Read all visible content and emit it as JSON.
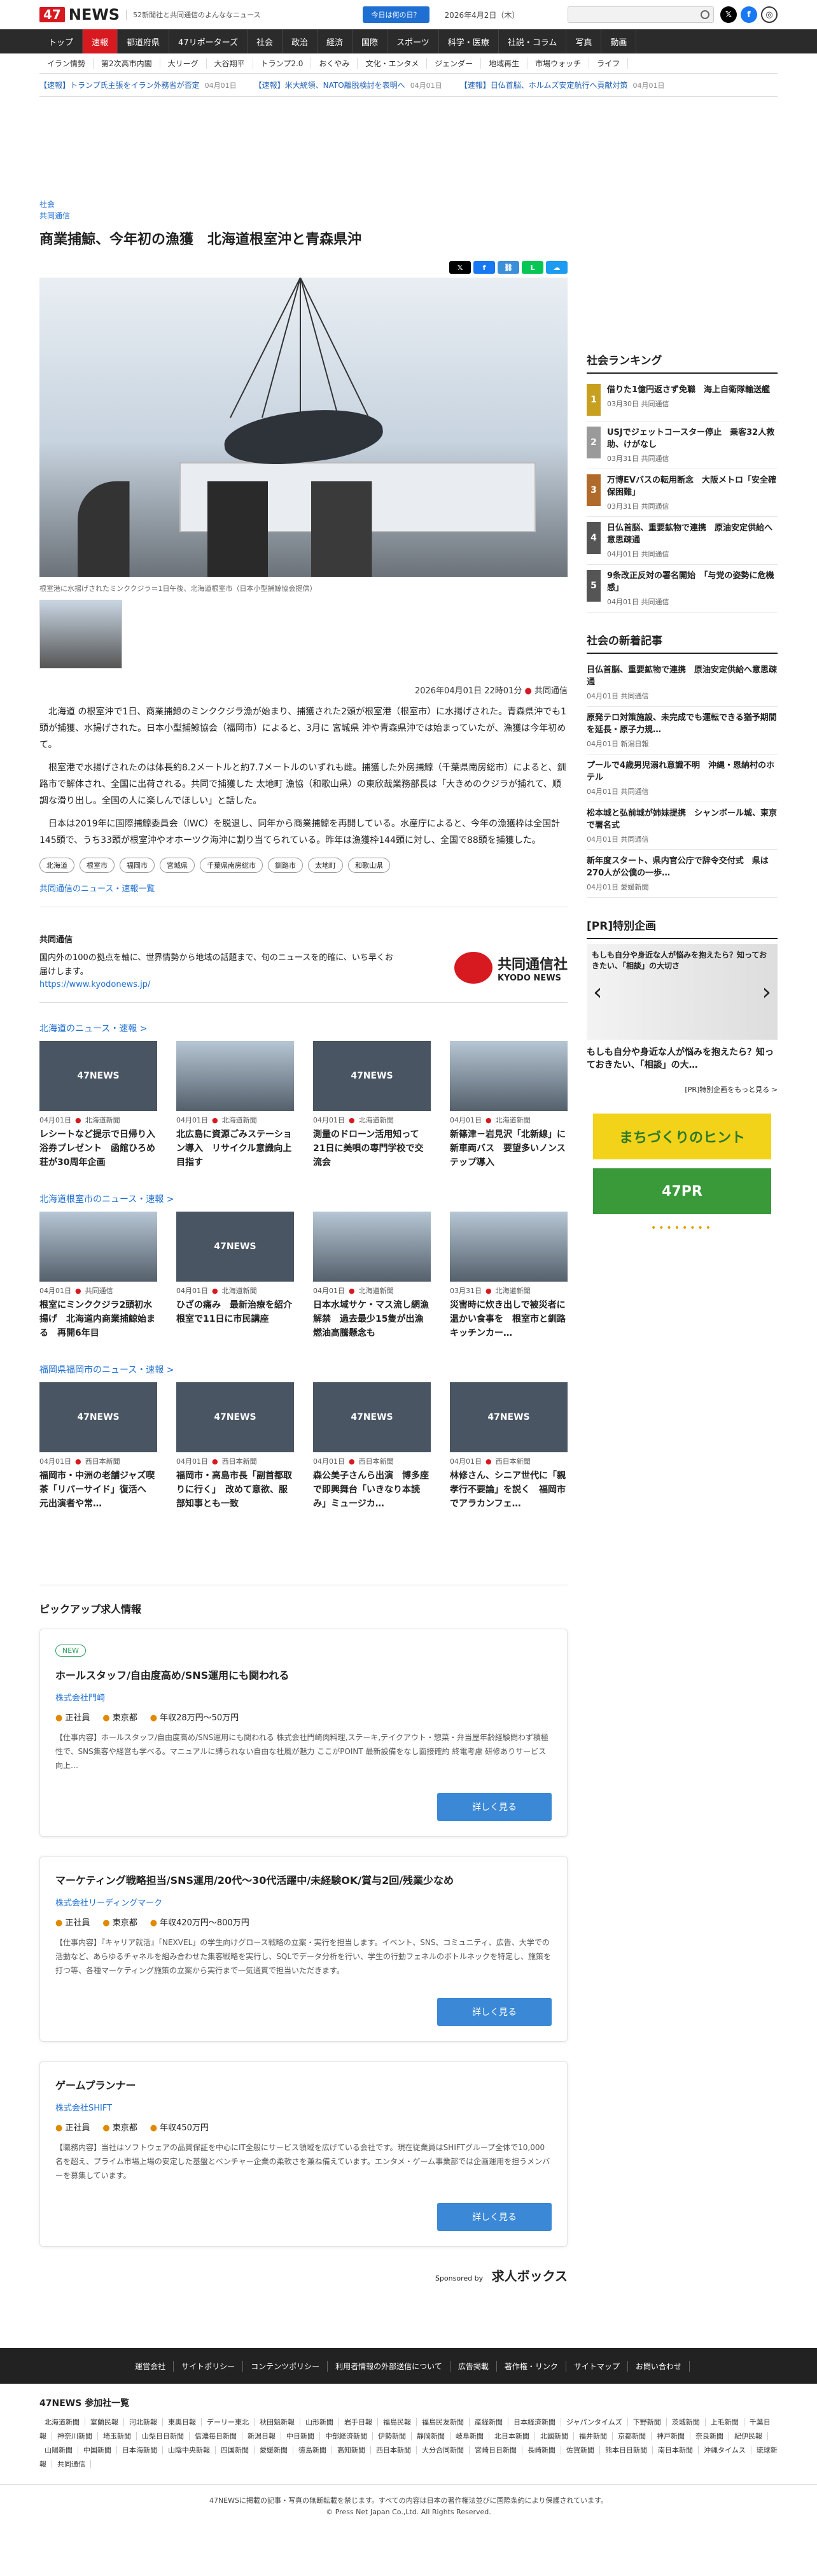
{
  "header": {
    "logo_num": "47",
    "logo_text": "NEWS",
    "tagline": "52新聞社と共同通信のよんななニュース",
    "today_button": "今日は何の日？",
    "date": "2026年4月2日（木）"
  },
  "gnav": [
    "トップ",
    "速報",
    "都道府県",
    "47リポーターズ",
    "社会",
    "政治",
    "経済",
    "国際",
    "スポーツ",
    "科学・医療",
    "社説・コラム",
    "写真",
    "動画"
  ],
  "subnav": [
    "イラン情勢",
    "第2次高市内閣",
    "大リーグ",
    "大谷翔平",
    "トランプ2.0",
    "おくやみ",
    "文化・エンタメ",
    "ジェンダー",
    "地域再生",
    "市場ウォッチ",
    "ライフ"
  ],
  "breaking": [
    {
      "text": "【速報】トランプ氏主張をイラン外務省が否定",
      "date": "04月01日"
    },
    {
      "text": "【速報】米大統領、NATO離脱検討を表明へ",
      "date": "04月01日"
    },
    {
      "text": "【速報】日仏首脳、ホルムズ安定航行へ貢献対策",
      "date": "04月01日"
    }
  ],
  "article": {
    "category": "社会",
    "source_top": "共同通信",
    "title": "商業捕鯨、今年初の漁獲　北海道根室沖と青森県沖",
    "caption": "根室港に水揚げされたミンククジラ＝1日午後、北海道根室市（日本小型捕鯨協会提供）",
    "datetime": "2026年04月01日 22時01分",
    "source": "共同通信",
    "paragraphs": [
      "北海道 の根室沖で1日、商業捕鯨のミンククジラ漁が始まり、捕獲された2頭が根室港（根室市）に水揚げされた。青森県沖でも1頭が捕獲、水揚げされた。日本小型捕鯨協会（福岡市）によると、3月に 宮城県 沖や青森県沖では始まっていたが、漁獲は今年初めて。",
      "根室港で水揚げされたのは体長約8.2メートルと約7.7メートルのいずれも雌。捕獲した外房捕鯨（千葉県南房総市）によると、釧路市で解体され、全国に出荷される。共同で捕獲した 太地町 漁協（和歌山県）の東欣哉業務部長は「大きめのクジラが捕れて、順調な滑り出し。全国の人に楽しんでほしい」と話した。",
      "日本は2019年に国際捕鯨委員会（IWC）を脱退し、同年から商業捕鯨を再開している。水産庁によると、今年の漁獲枠は全国計145頭で、うち33頭が根室沖やオホーツク海沖に割り当てられている。昨年は漁獲枠144頭に対し、全国で88頭を捕獲した。"
    ],
    "tags": [
      "北海道",
      "根室市",
      "福岡市",
      "宮城県",
      "千葉県南房総市",
      "釧路市",
      "太地町",
      "和歌山県"
    ],
    "more_link": "共同通信のニュース・速報一覧"
  },
  "kyodo": {
    "title": "共同通信",
    "desc": "国内外の100の拠点を軸に、世界情勢から地域の話題まで、旬のニュースを的確に、いち早くお届けします。",
    "url": "https://www.kyodonews.jp/",
    "logo_name": "共同通信社",
    "logo_en": "KYODO NEWS"
  },
  "sections": [
    {
      "heading": "北海道のニュース・速報 >",
      "cards": [
        {
          "img": "47NEWS",
          "date": "04月01日",
          "src": "北海道新聞",
          "title": "レシートなど提示で日帰り入浴券プレゼント　函館ひろめ荘が30周年企画"
        },
        {
          "img": "",
          "date": "04月01日",
          "src": "北海道新聞",
          "title": "北広島に資源ごみステーション導入　リサイクル意識向上目指す"
        },
        {
          "img": "47NEWS",
          "date": "04月01日",
          "src": "北海道新聞",
          "title": "測量のドローン活用知って　21日に美唄の専門学校で交流会"
        },
        {
          "img": "",
          "date": "04月01日",
          "src": "北海道新聞",
          "title": "新篠津－岩見沢「北新線」に新車両バス　要望多いノンステップ導入"
        }
      ]
    },
    {
      "heading": "北海道根室市のニュース・速報 >",
      "cards": [
        {
          "img": "",
          "date": "04月01日",
          "src": "共同通信",
          "title": "根室にミンククジラ2頭初水揚げ　北海道内商業捕鯨始まる　再開6年目"
        },
        {
          "img": "47NEWS",
          "date": "04月01日",
          "src": "北海道新聞",
          "title": "ひざの痛み　最新治療を紹介　根室で11日に市民講座"
        },
        {
          "img": "",
          "date": "04月01日",
          "src": "北海道新聞",
          "title": "日本水域サケ・マス流し網漁解禁　過去最少15隻が出漁　燃油高騰懸念も"
        },
        {
          "img": "",
          "date": "03月31日",
          "src": "北海道新聞",
          "title": "災害時に炊き出しで被災者に温かい食事を　根室市と釧路キッチンカー…"
        }
      ]
    },
    {
      "heading": "福岡県福岡市のニュース・速報 >",
      "cards": [
        {
          "img": "47NEWS",
          "date": "04月01日",
          "src": "西日本新聞",
          "title": "福岡市・中洲の老舗ジャズ喫茶「リバーサイド」復活へ　元出演者や常…"
        },
        {
          "img": "47NEWS",
          "date": "04月01日",
          "src": "西日本新聞",
          "title": "福岡市・高島市長「副首都取りに行く」　改めて意欲、服部知事とも一致"
        },
        {
          "img": "47NEWS",
          "date": "04月01日",
          "src": "西日本新聞",
          "title": "森公美子さんら出演　博多座で即興舞台「いきなり本読み」ミュージカ…"
        },
        {
          "img": "47NEWS",
          "date": "04月01日",
          "src": "西日本新聞",
          "title": "林修さん、シニア世代に「親孝行不要論」を説く　福岡市でアラカンフェ…"
        }
      ]
    }
  ],
  "pickup": {
    "heading": "ピックアップ求人情報",
    "jobs": [
      {
        "new": "NEW",
        "title": "ホールスタッフ/自由度高め/SNS運用にも関われる",
        "company": "株式会社門崎",
        "type": "正社員",
        "area": "東京都",
        "salary": "年収28万円～50万円",
        "desc": "【仕事内容】ホールスタッフ/自由度高め/SNS運用にも関われる 株式会社門崎肉料理,ステーキ,テイクアウト・惣菜・弁当屋年齢経験問わず積極性で、SNS集客や経営も学べる。マニュアルに縛られない自由な社風が魅力 ここがPOINT 最新設備をなし面接確約 終電考慮 研修ありサービス向上…",
        "button": "詳しく見る"
      },
      {
        "new": "",
        "title": "マーケティング戦略担当/SNS運用/20代～30代活躍中/未経験OK/賞与2回/残業少なめ",
        "company": "株式会社リーディングマーク",
        "type": "正社員",
        "area": "東京都",
        "salary": "年収420万円～800万円",
        "desc": "【仕事内容】『キャリア就活』「NEXVEL」の学生向けグロース戦略の立案・実行を担当します。イベント、SNS、コミュニティ、広告、大学での活動など、あらゆるチャネルを組み合わせた集客戦略を実行し、SQLでデータ分析を行い、学生の行動フェネルのボトルネックを特定し、施策を打つ等、各種マーケティング施策の立案から実行まで一気通貫で担当いただきます。",
        "button": "詳しく見る"
      },
      {
        "new": "",
        "title": "ゲームプランナー",
        "company": "株式会社SHIFT",
        "type": "正社員",
        "area": "東京都",
        "salary": "年収450万円",
        "desc": "【職務内容】当社はソフトウェアの品質保証を中心にIT全般にサービス領域を広げている会社です。現在従業員はSHIFTグループ全体で10,000名を超え、プライム市場上場の安定した基盤とベンチャー企業の柔軟さを兼ね備えています。エンタメ・ゲーム事業部では企画運用を担うメンバーを募集しています。",
        "button": "詳しく見る"
      }
    ],
    "sponsor_label": "Sponsored by",
    "sponsor_name": "求人ボックス"
  },
  "ranking": {
    "heading": "社会ランキング",
    "items": [
      {
        "no": "1",
        "title": "借りた1億円返さず免職　海上自衛隊輸送艦",
        "date": "03月30日",
        "src": "共同通信",
        "color": "#c8a020"
      },
      {
        "no": "2",
        "title": "USJでジェットコースター停止　乗客32人救助、けがなし",
        "date": "03月31日",
        "src": "共同通信",
        "color": "#9a9a9a"
      },
      {
        "no": "3",
        "title": "万博EVバスの転用断念　大阪メトロ「安全確保困難」",
        "date": "03月31日",
        "src": "共同通信",
        "color": "#b06a2a"
      },
      {
        "no": "4",
        "title": "日仏首脳、重要鉱物で連携　原油安定供給へ意思疎通",
        "date": "04月01日",
        "src": "共同通信",
        "color": "#555"
      },
      {
        "no": "5",
        "title": "9条改正反対の署名開始　「与党の姿勢に危機感」",
        "date": "04月01日",
        "src": "共同通信",
        "color": "#555"
      }
    ]
  },
  "newest": {
    "heading": "社会の新着記事",
    "items": [
      {
        "title": "日仏首脳、重要鉱物で連携　原油安定供給へ意思疎通",
        "date": "04月01日",
        "src": "共同通信"
      },
      {
        "title": "原発テロ対策施設、未完成でも運転できる猶予期間を延長・原子力規…",
        "date": "04月01日",
        "src": "新潟日報"
      },
      {
        "title": "プールで4歳男児溺れ意識不明　沖縄・恩納村のホテル",
        "date": "04月01日",
        "src": "共同通信"
      },
      {
        "title": "松本城と弘前城が姉妹提携　シャンボール城、東京で署名式",
        "date": "04月01日",
        "src": "共同通信"
      },
      {
        "title": "新年度スタート、県内官公庁で辞令交付式　県は270人が公僕の一歩…",
        "date": "04月01日",
        "src": "愛媛新聞"
      }
    ]
  },
  "pr": {
    "heading": "[PR]特別企画",
    "box_text": "もしも自分や身近な人が悩みを抱えたら？知っておきたい、「相談」の大切さ",
    "title": "もしも自分や身近な人が悩みを抱えたら？知っておきたい、「相談」の大…",
    "more": "[PR]特別企画をもっと見る >",
    "banner1": "まちづくりのヒント",
    "banner2": "47PR"
  },
  "footer": {
    "links": [
      "運営会社",
      "サイトポリシー",
      "コンテンツポリシー",
      "利用者情報の外部送信について",
      "広告掲載",
      "著作権・リンク",
      "サイトマップ",
      "お問い合わせ"
    ],
    "sites_heading": "47NEWS 参加社一覧",
    "sites": [
      "北海道新聞",
      "室蘭民報",
      "河北新報",
      "東奥日報",
      "デーリー東北",
      "秋田魁新報",
      "山形新聞",
      "岩手日報",
      "福島民報",
      "福島民友新聞",
      "産経新聞",
      "日本経済新聞",
      "ジャパンタイムズ",
      "下野新聞",
      "茨城新聞",
      "上毛新聞",
      "千葉日報",
      "神奈川新聞",
      "埼玉新聞",
      "山梨日日新聞",
      "信濃毎日新聞",
      "新潟日報",
      "中日新聞",
      "中部経済新聞",
      "伊勢新聞",
      "静岡新聞",
      "岐阜新聞",
      "北日本新聞",
      "北國新聞",
      "福井新聞",
      "京都新聞",
      "神戸新聞",
      "奈良新聞",
      "紀伊民報",
      "山陽新聞",
      "中国新聞",
      "日本海新聞",
      "山陰中央新報",
      "四国新聞",
      "愛媛新聞",
      "徳島新聞",
      "高知新聞",
      "西日本新聞",
      "大分合同新聞",
      "宮崎日日新聞",
      "長崎新聞",
      "佐賀新聞",
      "熊本日日新聞",
      "南日本新聞",
      "沖縄タイムス",
      "琉球新報",
      "共同通信"
    ],
    "copy1": "47NEWSに掲載の記事・写真の無断転載を禁じます。すべての内容は日本の著作権法並びに国際条約により保護されています。",
    "copy2": "© Press Net Japan Co.,Ltd. All Rights Reserved."
  },
  "colors": {
    "brand_red": "#d71920",
    "link_blue": "#1e6fd1",
    "nav_dark": "#2b2b2b"
  }
}
